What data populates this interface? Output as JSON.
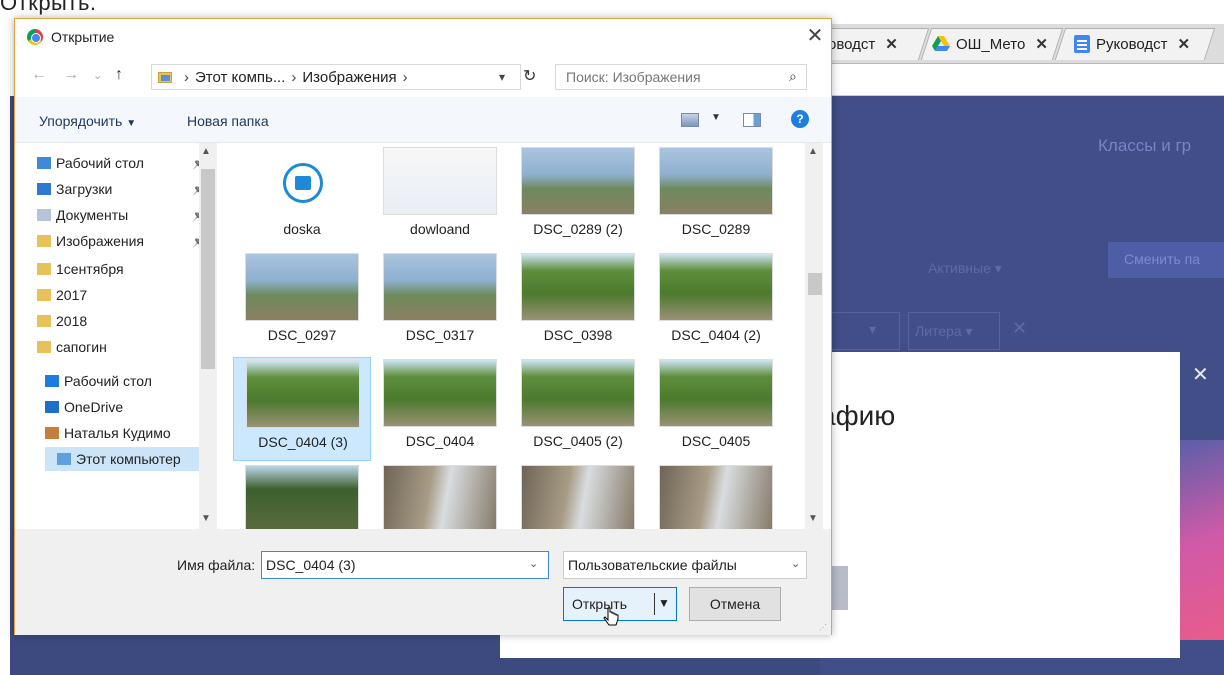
{
  "caption": "Открыть.",
  "browser": {
    "tabs": [
      {
        "label": "оводст",
        "icon": "docs-icon"
      },
      {
        "label": "ОШ_Мето",
        "icon": "drive-icon"
      },
      {
        "label": "Руководст",
        "icon": "docs-icon"
      }
    ],
    "page": {
      "classes_title": "Классы и гр",
      "active_filter": "Активные",
      "change_button": "Сменить па",
      "litera_filter": "Литера",
      "modal_title": "афию"
    }
  },
  "dialog": {
    "title": "Открытие",
    "breadcrumb": [
      "Этот компь...",
      "Изображения"
    ],
    "search_placeholder": "Поиск: Изображения",
    "toolbar": {
      "sort_label": "Упорядочить",
      "new_folder_label": "Новая папка"
    },
    "nav_items": [
      {
        "label": "Рабочий стол",
        "icon": "desktop-folder-icon",
        "pinned": true
      },
      {
        "label": "Загрузки",
        "icon": "downloads-folder-icon",
        "pinned": true
      },
      {
        "label": "Документы",
        "icon": "documents-folder-icon",
        "pinned": true
      },
      {
        "label": "Изображения",
        "icon": "pictures-folder-icon",
        "pinned": true
      },
      {
        "label": "1сентября",
        "icon": "folder-icon",
        "pinned": false
      },
      {
        "label": "2017",
        "icon": "folder-icon",
        "pinned": false
      },
      {
        "label": "2018",
        "icon": "folder-icon",
        "pinned": false
      },
      {
        "label": "сапогин",
        "icon": "folder-icon",
        "pinned": false
      },
      {
        "label": "Рабочий стол",
        "icon": "desktop-icon",
        "pinned": false
      },
      {
        "label": "OneDrive",
        "icon": "onedrive-icon",
        "pinned": false
      },
      {
        "label": "Наталья Кудимо",
        "icon": "user-icon",
        "pinned": false
      },
      {
        "label": "Этот компьютер",
        "icon": "computer-icon",
        "pinned": false
      }
    ],
    "files": [
      {
        "name": "doska",
        "kind": "app"
      },
      {
        "name": "dowloand",
        "kind": "screenshot"
      },
      {
        "name": "DSC_0289 (2)",
        "kind": "photo-sea"
      },
      {
        "name": "DSC_0289",
        "kind": "photo-sea"
      },
      {
        "name": "DSC_0297",
        "kind": "photo-sea"
      },
      {
        "name": "DSC_0317",
        "kind": "photo-sea"
      },
      {
        "name": "DSC_0398",
        "kind": "photo-green"
      },
      {
        "name": "DSC_0404 (2)",
        "kind": "photo-green"
      },
      {
        "name": "DSC_0404 (3)",
        "kind": "photo-green",
        "selected": true
      },
      {
        "name": "DSC_0404",
        "kind": "photo-green"
      },
      {
        "name": "DSC_0405 (2)",
        "kind": "photo-green"
      },
      {
        "name": "DSC_0405",
        "kind": "photo-green"
      },
      {
        "name": "",
        "kind": "photo-forest"
      },
      {
        "name": "",
        "kind": "photo-rock"
      },
      {
        "name": "",
        "kind": "photo-rock"
      },
      {
        "name": "",
        "kind": "photo-rock"
      }
    ],
    "file_name_label": "Имя файла:",
    "file_name_value": "DSC_0404 (3)",
    "file_type_value": "Пользовательские файлы",
    "open_label": "Открыть",
    "cancel_label": "Отмена"
  },
  "colors": {
    "accent": "#0078d7",
    "selection": "#cce8ff",
    "page_bg": "#3d4a80",
    "dialog_border": "#e6a33d"
  }
}
